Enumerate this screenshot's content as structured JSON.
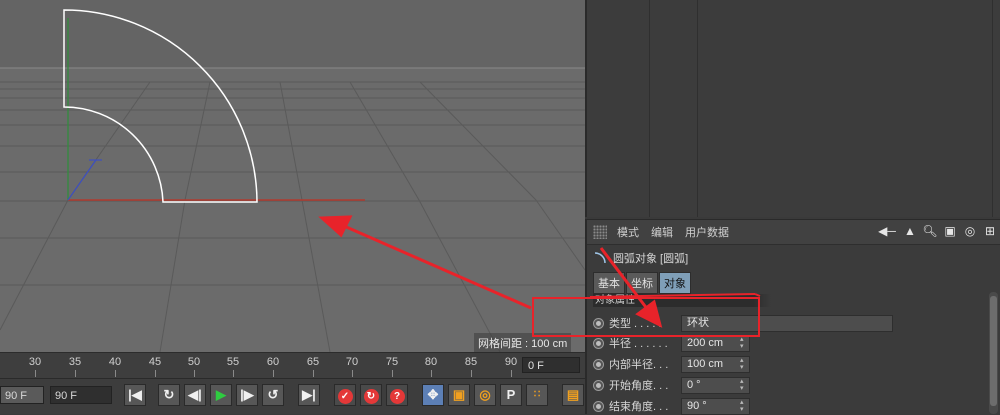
{
  "viewport": {
    "grid_spacing_label": "网格间距 : 100 cm"
  },
  "attributes": {
    "menu": [
      "模式",
      "编辑",
      "用户数据"
    ],
    "object_title": "圆弧对象 [圆弧]",
    "tabs": [
      "基本",
      "坐标",
      "对象"
    ],
    "active_tab": "对象",
    "section_title": "对象属性",
    "props": [
      {
        "label": "类型 . . . . .",
        "value": "环状"
      },
      {
        "label": "半径 . . . . . .",
        "value": "200 cm"
      },
      {
        "label": "内部半径. . .",
        "value": "100 cm"
      },
      {
        "label": "开始角度. . .",
        "value": "0 °"
      },
      {
        "label": "结束角度. . .",
        "value": "90 °"
      }
    ],
    "toolbar_icons": [
      "arrow-left-icon",
      "arrow-up-icon",
      "search-icon",
      "lock-icon",
      "target-icon",
      "add-panel-icon"
    ]
  },
  "timeline": {
    "ticks": [
      "30",
      "35",
      "40",
      "45",
      "50",
      "55",
      "60",
      "65",
      "70",
      "75",
      "80",
      "85",
      "90"
    ],
    "current_frame": "0 F"
  },
  "transport": {
    "left_field": "90 F",
    "end_field": "90 F"
  },
  "colors": {
    "annotation_red": "#e8232a",
    "play_green": "#2ecc40",
    "record_red": "#e43838",
    "active_tab_blue": "#7f9fb8"
  }
}
